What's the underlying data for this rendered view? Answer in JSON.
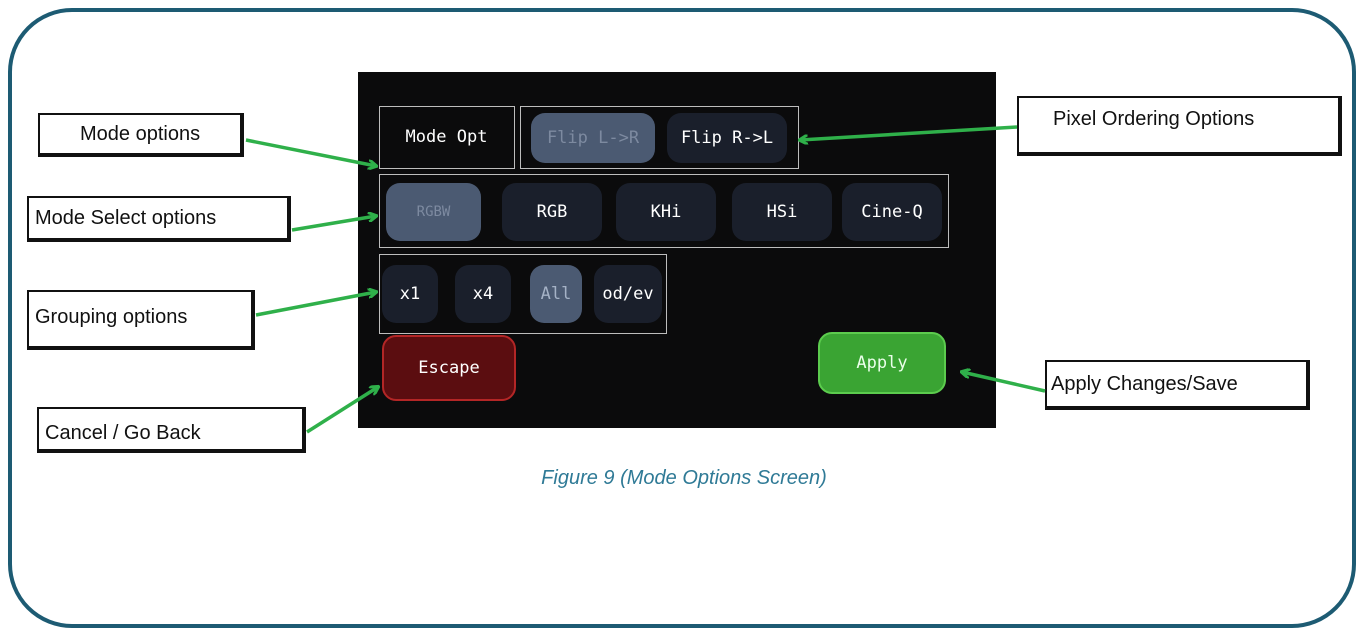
{
  "screen": {
    "mode_label": "Mode Opt",
    "pixel_order": [
      "Flip L->R",
      "Flip R->L"
    ],
    "pixel_order_selected": "Flip L->R",
    "modes": [
      "RGBW",
      "RGB",
      "KHi",
      "HSi",
      "Cine-Q"
    ],
    "mode_selected": "RGBW",
    "grouping": [
      "x1",
      "x4",
      "All",
      "od/ev"
    ],
    "grouping_selected": "All",
    "escape_label": "Escape",
    "apply_label": "Apply"
  },
  "callouts": {
    "mode_options": "Mode options",
    "mode_select_options": "Mode Select options",
    "grouping_options": "Grouping options",
    "cancel": "Cancel / Go Back",
    "pixel_ordering": "Pixel Ordering Options",
    "apply": "Apply Changes/Save"
  },
  "caption": "Figure 9 (Mode Options Screen)",
  "colors": {
    "frame": "#1d5b73",
    "arrow": "#2fb04a",
    "caption": "#2f7a96",
    "screen_bg": "#0b0b0c",
    "selected_button": "#4b5a72",
    "escape": "#5b0d10",
    "apply": "#3aa433"
  }
}
